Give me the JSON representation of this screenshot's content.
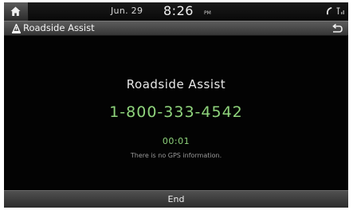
{
  "status_bar": {
    "date": "Jun. 29",
    "time": "8:26",
    "ampm": "PM",
    "home_icon": "home-icon",
    "phone_icon": "phone-connected-icon",
    "signal_icon": "signal-icon"
  },
  "title_bar": {
    "title": "Roadside Assist",
    "title_icon": "roadside-assist-icon",
    "back_icon": "back-arrow-icon"
  },
  "call": {
    "service_name": "Roadside Assist",
    "phone_number": "1-800-333-4542",
    "duration": "00:01",
    "gps_message": "There is no GPS information."
  },
  "end_button": {
    "label": "End"
  },
  "colors": {
    "background": "#030303",
    "accent_green": "#8fd47c",
    "text": "#e8e8e8",
    "button": "#3e3e3e"
  }
}
